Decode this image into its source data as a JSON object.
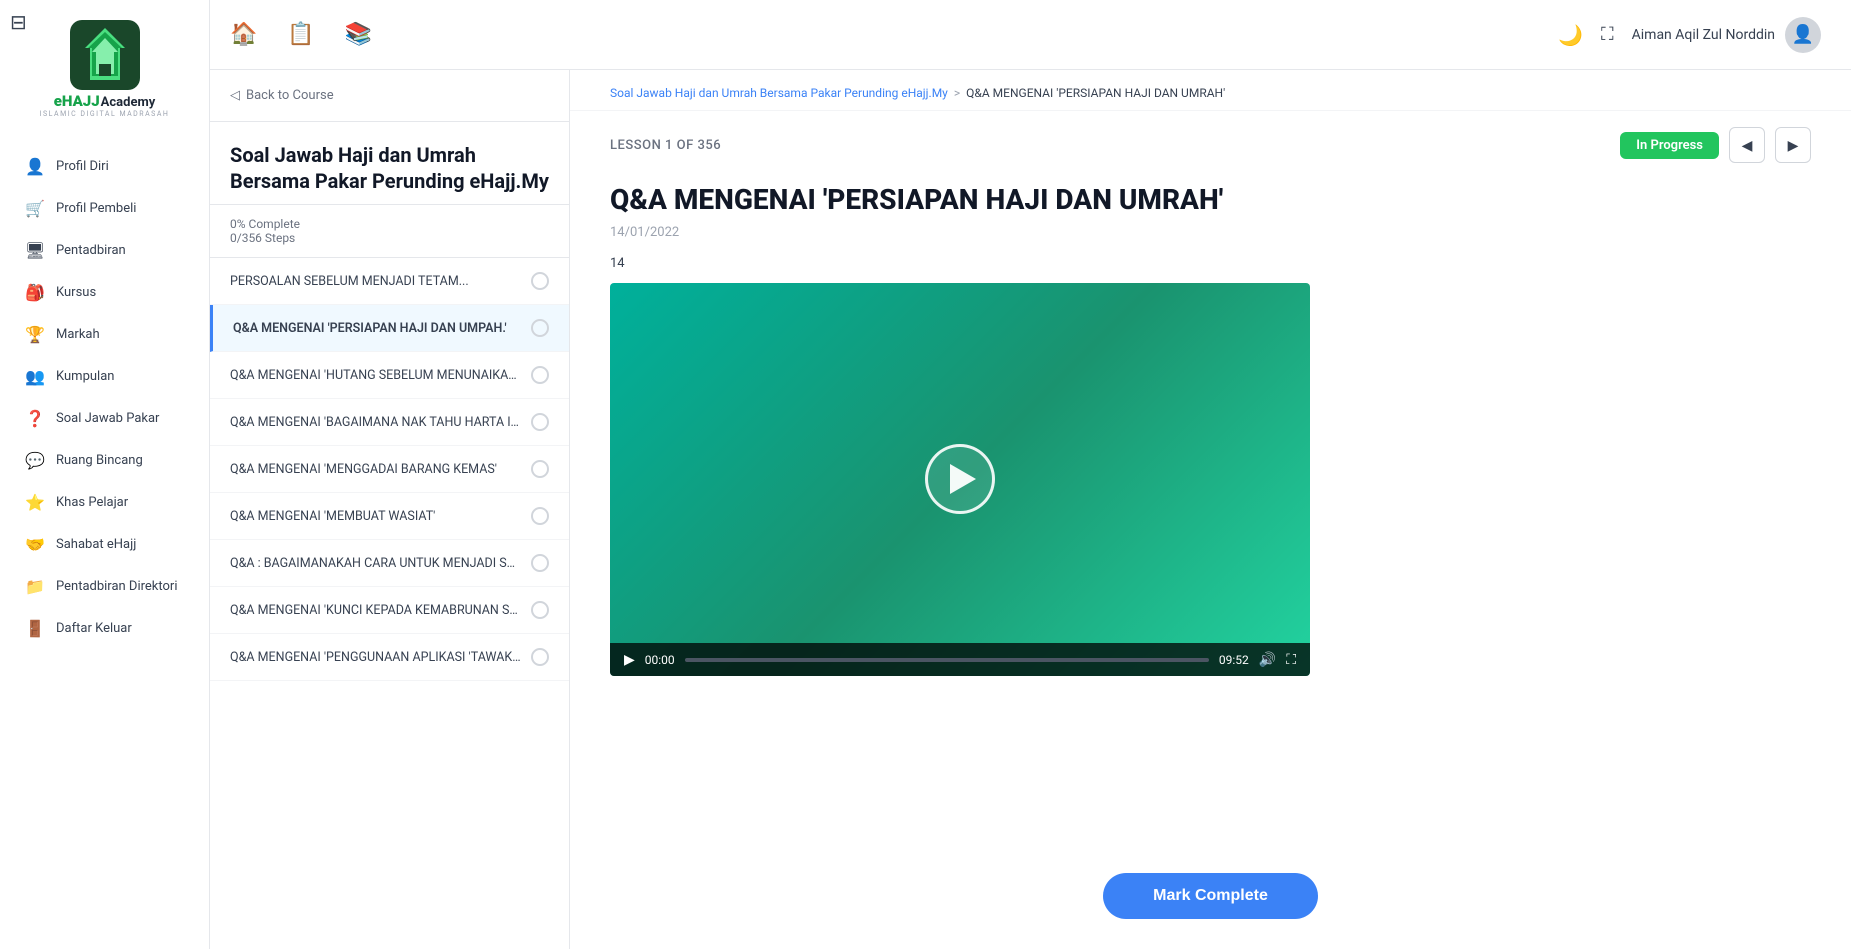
{
  "app": {
    "toggle_label": "☰",
    "title": "eHAJJ Academy",
    "subtitle": "ISLAMIC DIGITAL MADRASAH"
  },
  "topbar": {
    "icons": [
      {
        "name": "home-icon",
        "symbol": "🏠"
      },
      {
        "name": "briefcase-icon",
        "symbol": "📋"
      },
      {
        "name": "book-icon",
        "symbol": "📚"
      }
    ],
    "right": {
      "theme_icon": "🌙",
      "expand_icon": "⛶",
      "user_name": "Aiman Aqil Zul Norddin"
    }
  },
  "sidebar": {
    "items": [
      {
        "label": "Profil Diri",
        "icon": "👤"
      },
      {
        "label": "Profil Pembeli",
        "icon": "🛒"
      },
      {
        "label": "Pentadbiran",
        "icon": "🖥"
      },
      {
        "label": "Kursus",
        "icon": "🎒"
      },
      {
        "label": "Markah",
        "icon": "🏆"
      },
      {
        "label": "Kumpulan",
        "icon": "👥"
      },
      {
        "label": "Soal Jawab Pakar",
        "icon": "❓"
      },
      {
        "label": "Ruang Bincang",
        "icon": "💬"
      },
      {
        "label": "Khas Pelajar",
        "icon": "⭐"
      },
      {
        "label": "Sahabat eHajj",
        "icon": "🤝"
      },
      {
        "label": "Pentadbiran Direktori",
        "icon": "📁"
      },
      {
        "label": "Daftar Keluar",
        "icon": "🚪"
      }
    ]
  },
  "course_panel": {
    "back_label": "Back to Course",
    "course_title": "Soal Jawab Haji dan Umrah Bersama Pakar Perunding eHajj.My",
    "progress_percent": "0% Complete",
    "progress_steps": "0/356 Steps",
    "lessons": [
      {
        "title": "PERSOALAN SEBELUM MENJADI TETAM...",
        "active": false
      },
      {
        "title": "Q&A MENGENAI 'PERSIAPAN HAJI DAN UMPAH.'",
        "active": true
      },
      {
        "title": "Q&A MENGENAI 'HUTANG SEBELUM MENUNAIKAN H",
        "active": false
      },
      {
        "title": "Q&A MENGENAI 'BAGAIMANA NAK TAHU HARTA ITU",
        "active": false
      },
      {
        "title": "Q&A MENGENAI 'MENGGADAI BARANG KEMAS'",
        "active": false
      },
      {
        "title": "Q&A MENGENAI 'MEMBUAT WASIAT'",
        "active": false
      },
      {
        "title": "Q&A : BAGAIMANAKAH CARA UNTUK MENJADI SEO",
        "active": false
      },
      {
        "title": "Q&A MENGENAI 'KUNCI KEPADA KEMABRUNAN SESU",
        "active": false
      },
      {
        "title": "Q&A MENGENAI 'PENGGUNAAN APLIKASI 'TAWAKKA",
        "active": false
      }
    ]
  },
  "breadcrumb": {
    "course": "Soal Jawab Haji dan Umrah Bersama Pakar Perunding eHajj.My",
    "separator": ">",
    "current": "Q&A MENGENAI 'PERSIAPAN HAJI DAN UMRAH'"
  },
  "lesson": {
    "number_label": "LESSON 1 OF 356",
    "status": "In Progress",
    "title": "Q&A MENGENAI 'PERSIAPAN HAJI DAN UMRAH'",
    "date": "14/01/2022",
    "views": "14",
    "video": {
      "current_time": "00:00",
      "end_time": "09:52",
      "progress": 0
    }
  },
  "actions": {
    "mark_complete": "Mark Complete",
    "prev_label": "◀",
    "next_label": "▶"
  }
}
